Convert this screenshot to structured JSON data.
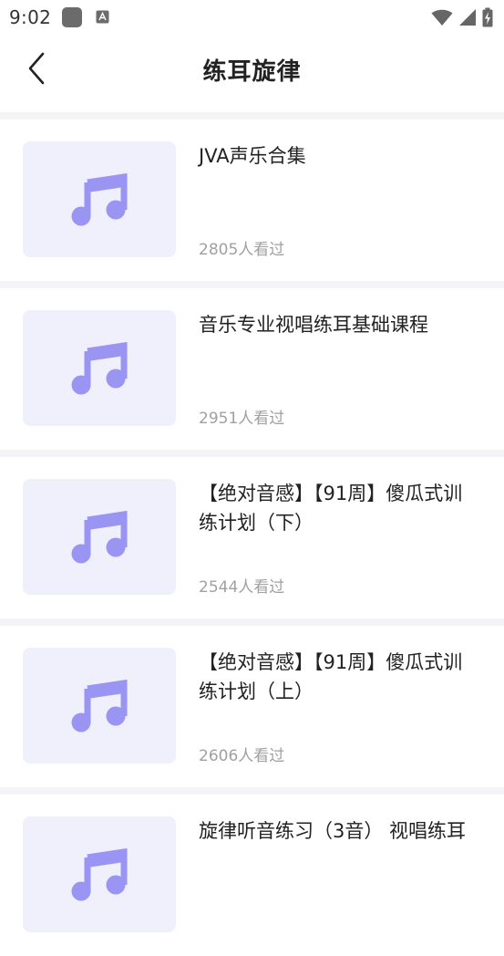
{
  "status_bar": {
    "time": "9:02"
  },
  "header": {
    "title": "练耳旋律"
  },
  "courses": [
    {
      "title": "JVA声乐合集",
      "views": "2805人看过"
    },
    {
      "title": "音乐专业视唱练耳基础课程",
      "views": "2951人看过"
    },
    {
      "title": "【绝对音感】【91周】傻瓜式训练计划（下）",
      "views": "2544人看过"
    },
    {
      "title": "【绝对音感】【91周】傻瓜式训练计划（上）",
      "views": "2606人看过"
    },
    {
      "title": "旋律听音练习（3音） 视唱练耳",
      "views": ""
    }
  ],
  "colors": {
    "music_icon": "#9a94f2",
    "thumb_bg": "#f0effc",
    "divider": "#f4f4f6"
  }
}
